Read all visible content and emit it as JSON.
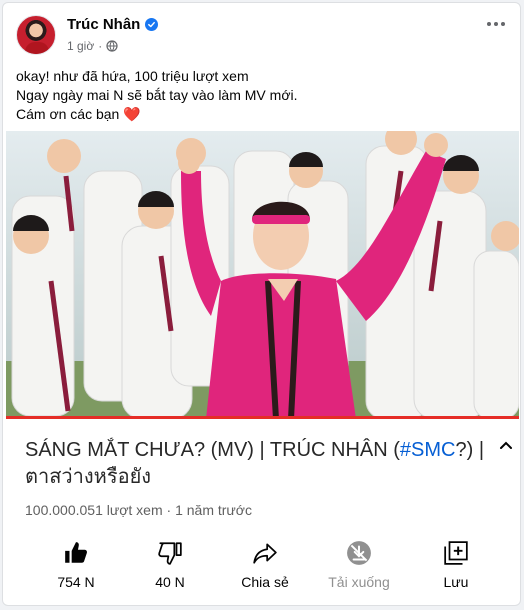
{
  "post": {
    "author": "Trúc Nhân",
    "time": "1 giờ",
    "separator": "·",
    "caption_lines": [
      "okay! như đã hứa, 100 triệu lượt xem",
      "Ngay ngày mai N sẽ bắt tay vào làm MV mới.",
      "Cám ơn các bạn"
    ],
    "caption_emoji": "❤️"
  },
  "video": {
    "title_part1": "SÁNG MẮT CHƯA? (MV) | TRÚC NHÂN (",
    "hashtag": "#SMC",
    "title_part2": "?) | ตาสว่างหรือยัง",
    "stats": "100.000.051 lượt xem · 1 năm trước",
    "progress": 1.0
  },
  "actions": [
    {
      "label": "754 N",
      "icon": "thumbs-up-icon"
    },
    {
      "label": "40 N",
      "icon": "thumbs-down-icon"
    },
    {
      "label": "Chia sẻ",
      "icon": "share-icon"
    },
    {
      "label": "Tải xuống",
      "icon": "download-disabled-icon"
    },
    {
      "label": "Lưu",
      "icon": "save-playlist-icon"
    }
  ],
  "colors": {
    "accent": "#1877f2",
    "hashtag": "#065fd4",
    "progress": "#e52d27",
    "dancer_lead": "#e0257c"
  }
}
